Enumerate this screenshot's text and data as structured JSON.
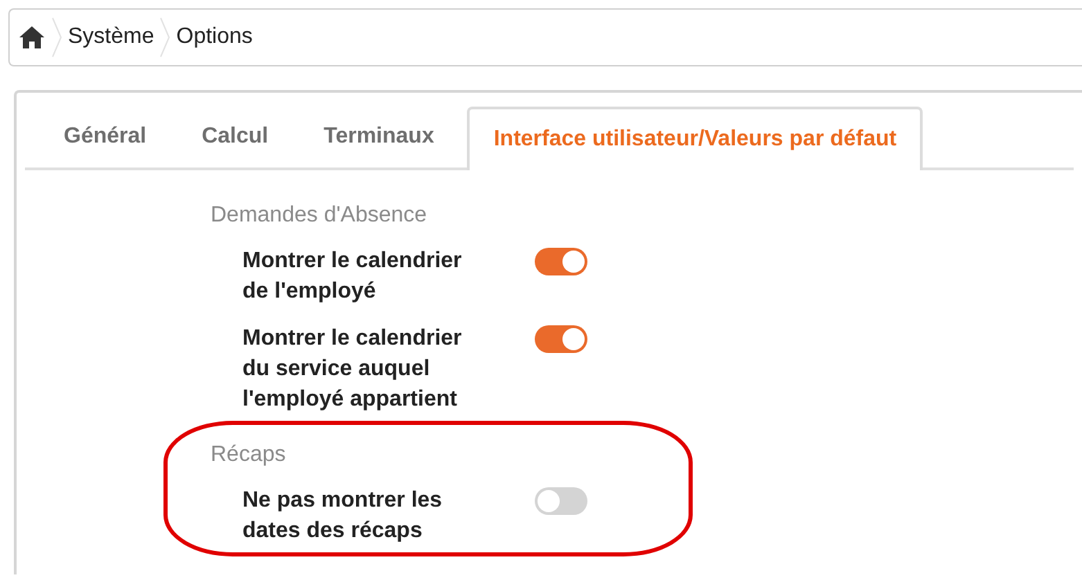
{
  "breadcrumb": [
    "Système",
    "Options"
  ],
  "tabs": [
    {
      "label": "Général",
      "selected": false
    },
    {
      "label": "Calcul",
      "selected": false
    },
    {
      "label": "Terminaux",
      "selected": false
    },
    {
      "label": "Interface utilisateur/Valeurs par défaut",
      "selected": true
    }
  ],
  "sections": [
    {
      "title": "Demandes d'Absence",
      "highlighted": false,
      "options": [
        {
          "label": "Montrer le calendrier de l'employé",
          "on": true
        },
        {
          "label": "Montrer le calendrier du service auquel l'employé appartient",
          "on": true
        }
      ]
    },
    {
      "title": "Récaps",
      "highlighted": true,
      "options": [
        {
          "label": "Ne pas montrer les dates des récaps",
          "on": false
        }
      ]
    }
  ]
}
